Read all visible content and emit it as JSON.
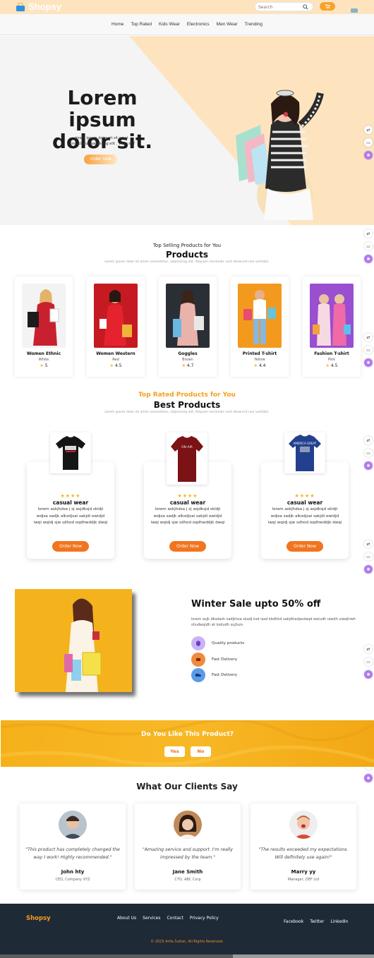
{
  "header": {
    "brand": "Shopsy",
    "search_placeholder": "Search"
  },
  "nav": {
    "items": [
      "Home",
      "Top Rated",
      "Kids Wear",
      "Electronics",
      "Men Wear",
      "Trending"
    ]
  },
  "hero": {
    "title_line1": "Lorem ipsum",
    "title_line2": "dolor sit.",
    "desc_line1": "lorem ipsum dolor sit sit amet",
    "desc_line2": "consectetur aadipising elit . Vitae ad?",
    "button": "order now"
  },
  "top_selling": {
    "subtitle": "Top Selling Products for You",
    "title": "Products",
    "desc": "Lorem ipsum dolor sit amet consectetur, adipisicing elit. Aliquam reiciendis sunt deserunt non veritatis.",
    "products": [
      {
        "name": "Women Ethnic",
        "color": "White",
        "rating": "5"
      },
      {
        "name": "Women Western",
        "color": "Red",
        "rating": "4.5"
      },
      {
        "name": "Goggles",
        "color": "Brown",
        "rating": "4.7"
      },
      {
        "name": "Printed T-shirt",
        "color": "Yellow",
        "rating": "4.4"
      },
      {
        "name": "Fashion T-shirt",
        "color": "Pink",
        "rating": "4.5"
      }
    ]
  },
  "best": {
    "subtitle": "Top Rated Products for You",
    "title": "Best Products",
    "desc": "Lorem ipsum dolor sit amet consectetur, adipisicing elit. Aliquam reiciendis sunt deserunt non veritatis.",
    "items": [
      {
        "stars": "★★★★",
        "name": "casual wear",
        "desc": "lorem askjhdsa j sj asjdksjd skldji wdjsa sadjk alksdjsai sakjdi ewidjd iwqi wqidj sjw sdhod oqdhwddjk dwqi",
        "button": "Order Now",
        "shirt_text": ""
      },
      {
        "stars": "★★★★",
        "name": "casual wear",
        "desc": "lorem askjhdsa j sj asjdksjd skldji wdjsa sadjk alksdjsai sakjdi ewidjd iwqi wqidj sjw sdhod oqdhwddjk dwqi",
        "button": "Order Now",
        "shirt_text": "ON AIR"
      },
      {
        "stars": "★★★★",
        "name": "casual wear",
        "desc": "lorem askjhdsa j sj asjdksjd skldji wdjsa sadjk alksdjsai sakjdi ewidjd iwqi wqidj sjw sdhod oqdhwddjk dwqi",
        "button": "Order Now",
        "shirt_text": "AMERICA GREAT"
      }
    ]
  },
  "winter": {
    "title": "Winter Sale upto 50% off",
    "desc": "lorem asjk dksdash sadjkhsa skadj ksd iasd kbdhkd sakjdhadjasiwqd ewiudh uiwdh uiwqhiwh shudwqidh sk ksdudh sujhuis",
    "features": [
      "Quality products",
      "Fast Delivery",
      "Fast Delivery"
    ],
    "feature_colors": [
      "#c9b2f5",
      "#f08a3c",
      "#5b9be8"
    ]
  },
  "banner": {
    "title": "Do You Like This Product?",
    "yes": "Yes",
    "no": "No"
  },
  "testimonials": {
    "title": "What Our Clients Say",
    "items": [
      {
        "quote": "\"This product has completely changed the way I work! Highly recommended.\"",
        "name": "John hty",
        "role": "CEO, Company XYZ"
      },
      {
        "quote": "\"Amazing service and support. I'm really impressed by the team.\"",
        "name": "Jane Smith",
        "role": "CTO, ABC Corp"
      },
      {
        "quote": "\"The results exceeded my expectations. Will definitely use again!\"",
        "name": "Marry yy",
        "role": "Manager, DEF Ltd"
      }
    ]
  },
  "footer": {
    "brand": "Shopsy",
    "links": [
      "About Us",
      "Services",
      "Contact",
      "Privacy Policy"
    ],
    "social": [
      "Facebook",
      "Twitter",
      "LinkedIn"
    ],
    "copyright": "© 2025 Arifa Sultan. All Rights Reserved."
  },
  "colors": {
    "accent": "#f59d21",
    "button_orange": "#f2741f",
    "banner_yellow": "#f5b11a",
    "footer_bg": "#1f2a37"
  },
  "icons": [
    "search-icon",
    "cart-icon",
    "star-icon",
    "quality-icon",
    "delivery-icon",
    "truck-icon",
    "translate-icon",
    "bookmark-icon",
    "extension-icon"
  ]
}
